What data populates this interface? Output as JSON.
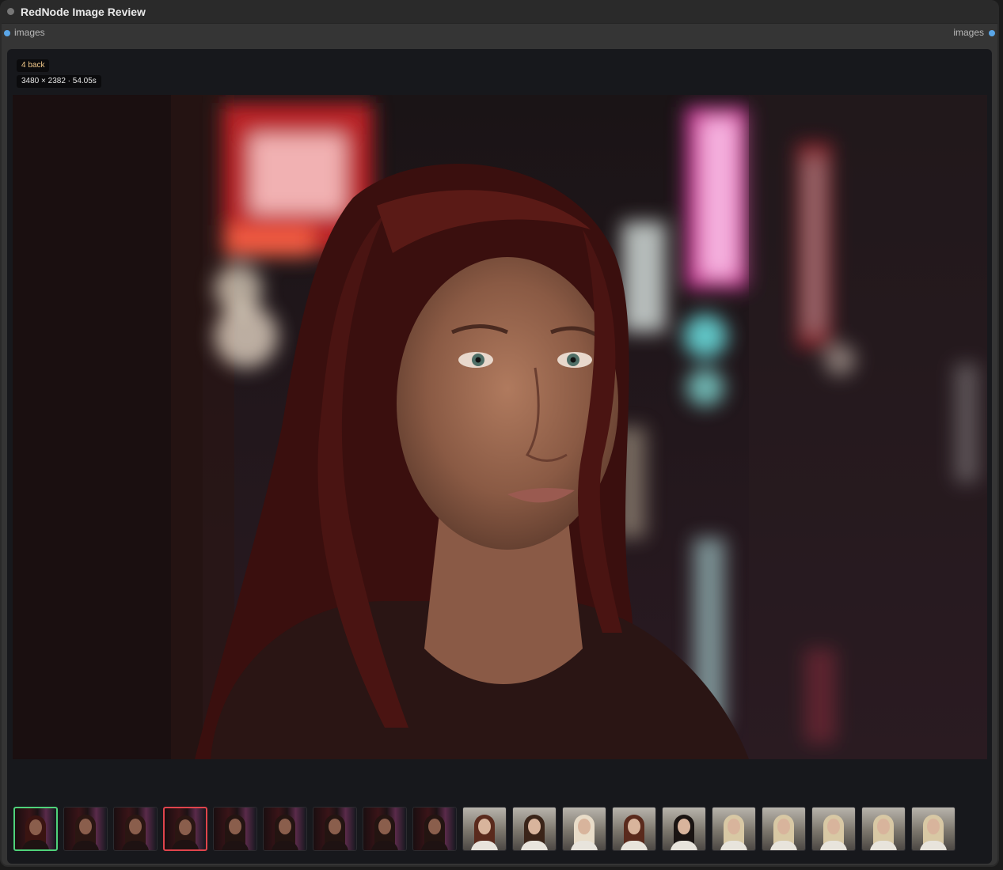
{
  "node": {
    "title": "RedNode Image Review",
    "input_slot": "images",
    "output_slot": "images"
  },
  "viewer": {
    "back_badge": "4 back",
    "meta_badge": "3480 × 2382 · 54.05s",
    "main_image_icon": "portrait-photo-icon"
  },
  "thumbnails": [
    {
      "state": "current",
      "scene": "night-neon",
      "hair": "#3a1411"
    },
    {
      "state": "normal",
      "scene": "night-neon",
      "hair": "#2a1612"
    },
    {
      "state": "normal",
      "scene": "night-neon",
      "hair": "#2a1612"
    },
    {
      "state": "flagged",
      "scene": "night-neon",
      "hair": "#2a1612"
    },
    {
      "state": "normal",
      "scene": "night-neon",
      "hair": "#231411"
    },
    {
      "state": "normal",
      "scene": "night-neon",
      "hair": "#231411"
    },
    {
      "state": "normal",
      "scene": "night-neon",
      "hair": "#231411"
    },
    {
      "state": "normal",
      "scene": "night-neon",
      "hair": "#231411"
    },
    {
      "state": "normal",
      "scene": "night-neon",
      "hair": "#231411"
    },
    {
      "state": "normal",
      "scene": "day-street",
      "hair": "#5a2a1c"
    },
    {
      "state": "normal",
      "scene": "day-street",
      "hair": "#3a2418"
    },
    {
      "state": "normal",
      "scene": "day-street",
      "hair": "#e8dcc8"
    },
    {
      "state": "normal",
      "scene": "day-street",
      "hair": "#5a2a1c"
    },
    {
      "state": "normal",
      "scene": "day-street",
      "hair": "#1a1412"
    },
    {
      "state": "normal",
      "scene": "day-street",
      "hair": "#d8c8a4"
    },
    {
      "state": "normal",
      "scene": "day-street",
      "hair": "#d8c8a4"
    },
    {
      "state": "normal",
      "scene": "day-street",
      "hair": "#d8c8a4"
    },
    {
      "state": "normal",
      "scene": "day-street",
      "hair": "#d8c8a4"
    },
    {
      "state": "normal",
      "scene": "day-street",
      "hair": "#d8c8a4"
    }
  ],
  "colors": {
    "current_border": "#4fd27a",
    "flagged_border": "#e0444c",
    "slot_dot": "#5aa6e8"
  }
}
